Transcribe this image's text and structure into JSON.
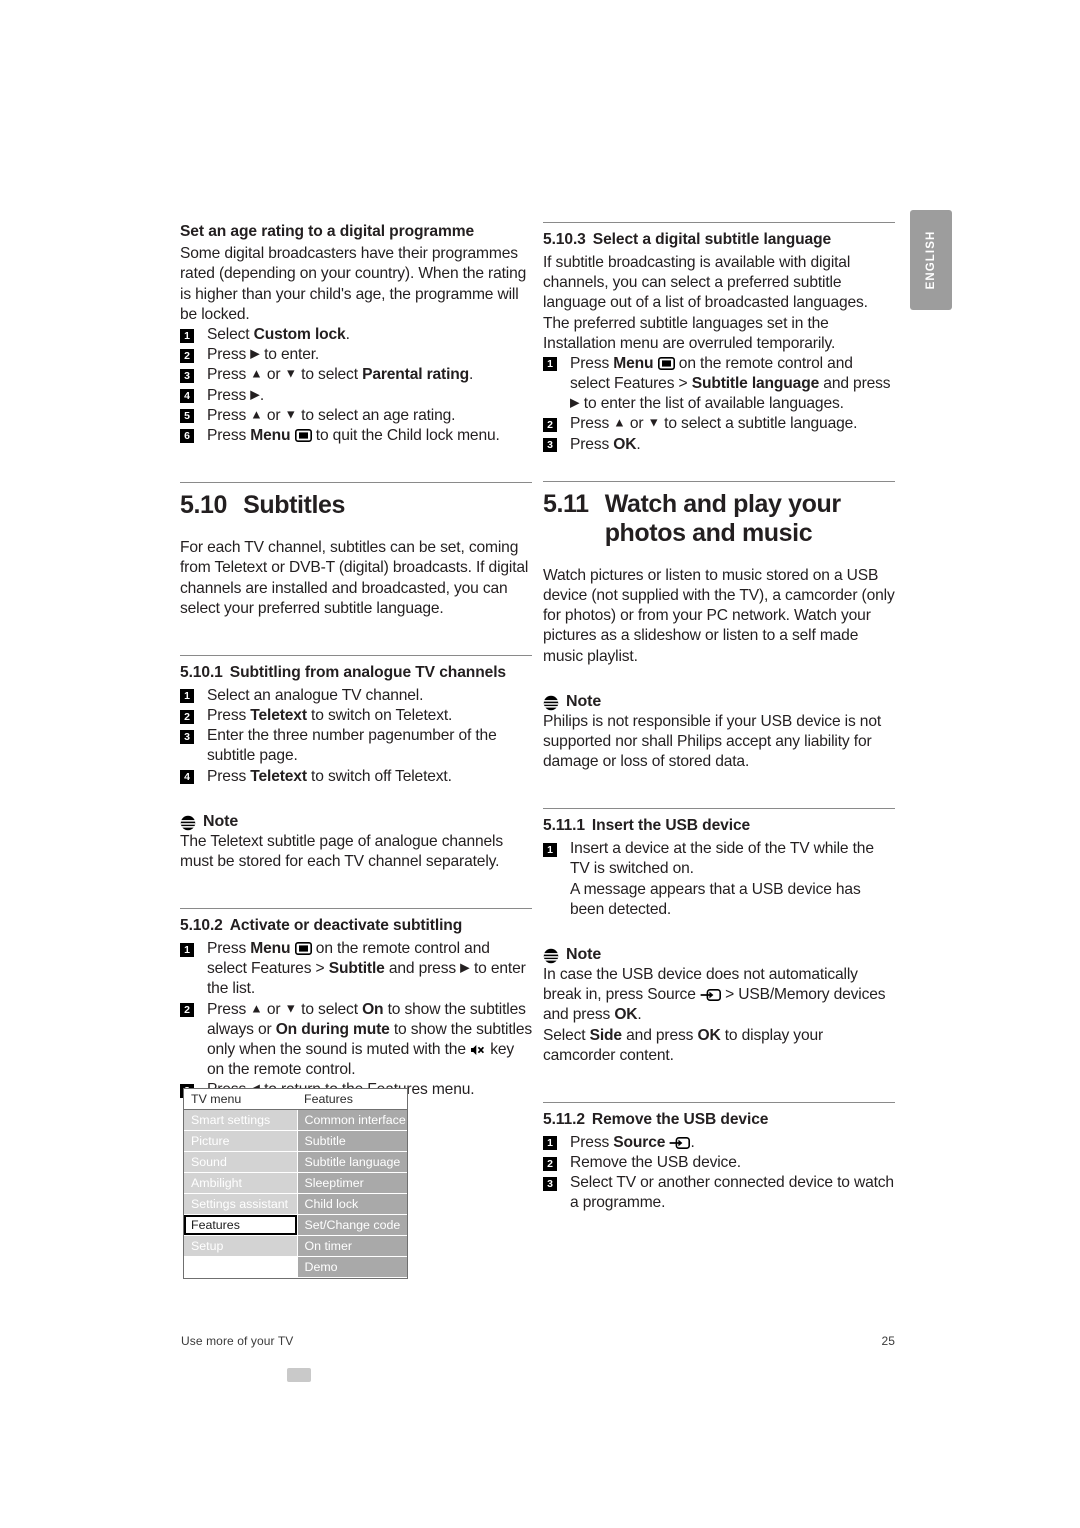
{
  "page": {
    "language_tab": "ENGLISH",
    "footer_left": "Use more of your TV",
    "footer_page": "25"
  },
  "left_column": {
    "age_rating": {
      "heading": "Set an age rating to a digital programme",
      "intro": "Some digital broadcasters have their programmes rated (depending on your country). When the rating is higher than your child's age, the programme will be locked.",
      "steps": [
        {
          "n": "1",
          "pre": "Select ",
          "bold": "Custom lock",
          "post": "."
        },
        {
          "n": "2",
          "pre": "Press ",
          "icon": "arrow-right",
          "post": " to enter."
        },
        {
          "n": "3",
          "pre": "Press ",
          "icon": "arrow-up-down",
          "mid": " to select ",
          "bold": "Parental rating",
          "post": "."
        },
        {
          "n": "4",
          "pre": "Press ",
          "icon": "arrow-right",
          "post": "."
        },
        {
          "n": "5",
          "pre": "Press ",
          "icon": "arrow-up-down",
          "post": " to select an age rating."
        },
        {
          "n": "6",
          "pre": "Press ",
          "bold": "Menu",
          "icon": "menu",
          "post": " to quit the Child lock menu."
        }
      ]
    },
    "subtitles_section": {
      "number": "5.10",
      "title": "Subtitles",
      "body": "For each TV channel, subtitles can be set, coming from Teletext or DVB-T (digital) broadcasts. If digital channels are installed and broadcasted, you can select your preferred subtitle language."
    },
    "s_5_10_1": {
      "number": "5.10.1",
      "title": "Subtitling from analogue TV channels",
      "steps": [
        {
          "n": "1",
          "text": "Select an analogue TV channel."
        },
        {
          "n": "2",
          "pre": "Press ",
          "bold": "Teletext",
          "post": " to switch on Teletext."
        },
        {
          "n": "3",
          "text": "Enter the three number pagenumber of the subtitle page."
        },
        {
          "n": "4",
          "pre": "Press ",
          "bold": "Teletext",
          "post": " to switch off Teletext."
        }
      ]
    },
    "note_1": {
      "label": "Note",
      "text": "The Teletext subtitle page of analogue channels must be stored for each TV channel separately."
    },
    "s_5_10_2": {
      "number": "5.10.2",
      "title": "Activate or deactivate subtitling",
      "step1": {
        "n": "1",
        "p1": "Press ",
        "b1": "Menu",
        "p2": " on the remote control and select Features > ",
        "b2": "Subtitle",
        "p3": " and press ",
        "p4": " to enter the list."
      },
      "step2": {
        "n": "2",
        "p1": "Press ",
        "p2": " to select ",
        "b1": "On",
        "p3": " to show the subtitles always or ",
        "b2": "On during mute",
        "p4": " to show the subtitles only when the sound is muted with the ",
        "p5": " key on the remote control."
      },
      "step3": {
        "n": "3",
        "p1": "Press ",
        "p2": " to return to the Features menu."
      }
    },
    "tv_menu": {
      "header_left": "TV menu",
      "header_right": "Features",
      "left_items": [
        "Smart settings",
        "Picture",
        "Sound",
        "Ambilight",
        "Settings assistant",
        "Features",
        "Setup",
        ""
      ],
      "selected_left": "Features",
      "right_items": [
        "Common interface",
        "Subtitle",
        "Subtitle language",
        "Sleeptimer",
        "Child lock",
        "Set/Change code",
        "On timer",
        "Demo"
      ]
    }
  },
  "right_column": {
    "s_5_10_3": {
      "number": "5.10.3",
      "title": "Select a digital subtitle language",
      "intro": "If subtitle broadcasting is available with digital channels, you can select a preferred subtitle language out of a list of broadcasted languages. The preferred subtitle languages set in the Installation menu are overruled temporarily.",
      "step1": {
        "n": "1",
        "p1": "Press ",
        "b1": "Menu",
        "p2": " on the remote control and select Features > ",
        "b2": "Subtitle language",
        "p3": " and press ",
        "p4": " to enter the list of available languages."
      },
      "step2": {
        "n": "2",
        "p1": "Press ",
        "p2": " to select a subtitle language."
      },
      "step3": {
        "n": "3",
        "p1": "Press ",
        "b1": "OK",
        "p2": "."
      }
    },
    "watch_section": {
      "number": "5.11",
      "title_line1": "Watch and play your",
      "title_line2": "photos and music",
      "body": "Watch pictures or listen to music stored on a USB device (not supplied with the TV), a camcorder (only for photos) or from your PC network. Watch your pictures as a slideshow or listen to a self made music playlist."
    },
    "note_2": {
      "label": "Note",
      "text": "Philips is not responsible if your USB device is not supported nor shall Philips accept any liability for damage or loss of stored data."
    },
    "s_5_11_1": {
      "number": "5.11.1",
      "title": "Insert the USB device",
      "step1_n": "1",
      "step1_text": "Insert a device at the side of the TV while the TV is switched on.",
      "step1_cont": "A message appears that a USB device has been detected."
    },
    "note_3": {
      "label": "Note",
      "p1": "In case the USB device does not automatically break in, press Source ",
      "p2": " > USB/Memory devices and press ",
      "b1": "OK",
      "p3": ".",
      "p4": "Select ",
      "b2": "Side",
      "p5": " and press ",
      "b3": "OK",
      "p6": " to display your camcorder content."
    },
    "s_5_11_2": {
      "number": "5.11.2",
      "title": "Remove the USB device",
      "step1": {
        "n": "1",
        "p1": "Press ",
        "b1": "Source",
        "p2": "."
      },
      "step2": {
        "n": "2",
        "text": "Remove the USB device."
      },
      "step3": {
        "n": "3",
        "text": "Select TV or another connected device to watch a programme."
      }
    }
  },
  "icons": {
    "note": "note-icon",
    "menu": "menu-icon",
    "source": "source-icon",
    "mute": "mute-icon",
    "arrow_right": "▶",
    "arrow_up": "▲",
    "arrow_down": "▼",
    "arrow_left": "◀"
  }
}
